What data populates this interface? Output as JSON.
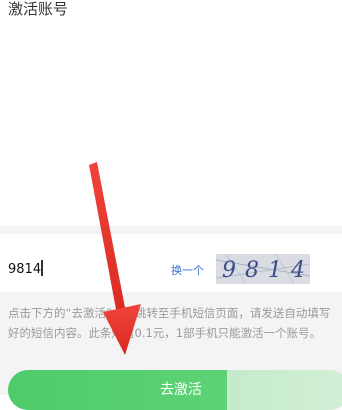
{
  "page": {
    "title": "激活账号"
  },
  "form": {
    "code_value": "9814",
    "refresh_label": "换一个",
    "captcha_text": "9814"
  },
  "notice": {
    "text": "点击下方的“去激活”，将跳转至手机短信页面，请发送自动填写好的短信内容。此条短信0.1元，1部手机只能激活一个账号。"
  },
  "actions": {
    "activate_label": "去激活"
  },
  "colors": {
    "primary_green": "#4ecb6a",
    "link_blue": "#3a6fd1",
    "arrow_red": "#e8322b"
  },
  "icons": {
    "overlay_arrow": "red-arrow-annotation"
  }
}
